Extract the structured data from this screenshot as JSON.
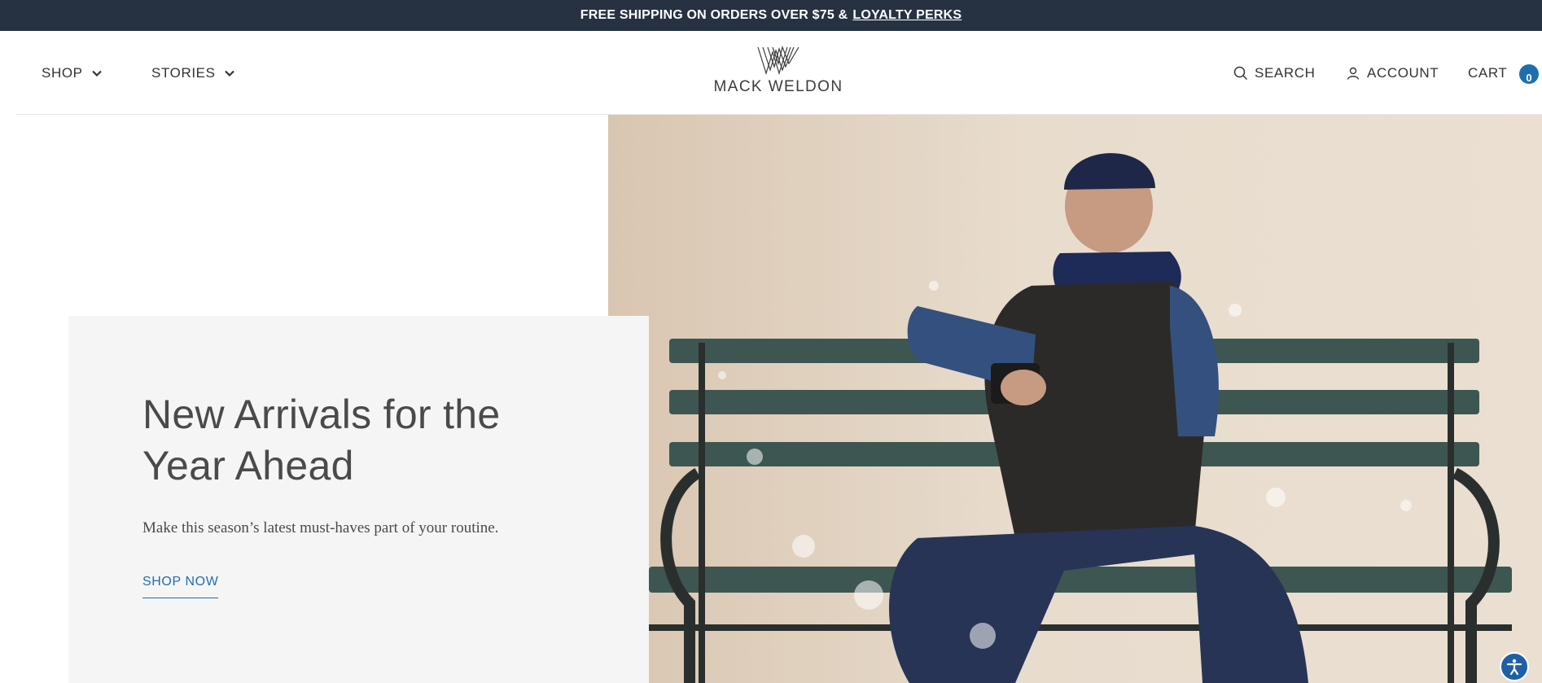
{
  "announcement": {
    "text": "FREE SHIPPING ON ORDERS OVER $75 &",
    "link": "LOYALTY PERKS"
  },
  "nav": {
    "shop": "SHOP",
    "stories": "STORIES"
  },
  "logo": {
    "text": "MACK WELDON"
  },
  "utility": {
    "search": "SEARCH",
    "account": "ACCOUNT",
    "cart": "CART",
    "cart_count": "0"
  },
  "hero": {
    "heading": "New Arrivals for the Year Ahead",
    "subtext": "Make this season’s latest must-haves part of your routine.",
    "cta": "SHOP NOW"
  },
  "colors": {
    "announcement_bg": "#263242",
    "accent": "#1f6fb0",
    "card_bg": "#f5f5f5"
  },
  "icons": {
    "search": "search-icon",
    "account": "account-icon",
    "chevron": "chevron-down-icon",
    "accessibility": "accessibility-icon"
  }
}
